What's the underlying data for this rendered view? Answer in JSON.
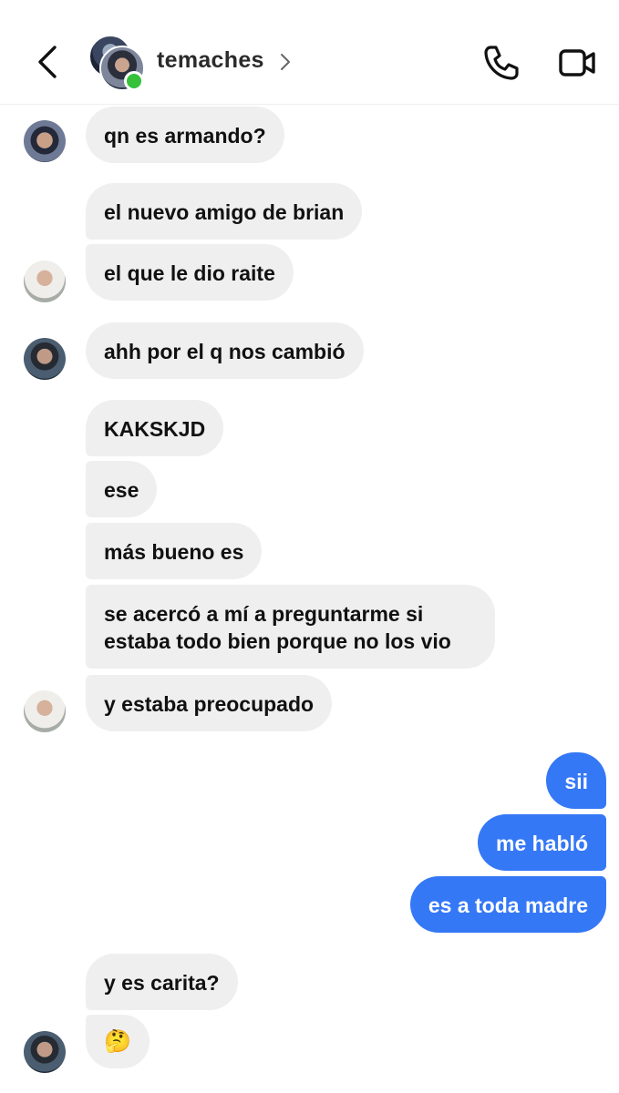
{
  "header": {
    "contact_name": "temaches",
    "online": true,
    "icons": {
      "back": "chevron-left-icon",
      "call": "phone-icon",
      "video": "video-camera-icon",
      "name": "chevron-right-icon"
    }
  },
  "messages": [
    {
      "from": "them",
      "text": "qn es armando?"
    },
    {
      "from": "them",
      "text": "el nuevo amigo de brian"
    },
    {
      "from": "them",
      "text": "el que le dio raite"
    },
    {
      "from": "them",
      "text": "ahh por el q nos cambió"
    },
    {
      "from": "them",
      "text": "KAKSKJD"
    },
    {
      "from": "them",
      "text": "ese"
    },
    {
      "from": "them",
      "text": "más bueno es"
    },
    {
      "from": "them",
      "text": "se acercó a mí a preguntarme si estaba todo bien porque no los vio"
    },
    {
      "from": "them",
      "text": "y estaba preocupado"
    },
    {
      "from": "me",
      "text": "sii"
    },
    {
      "from": "me",
      "text": "me habló"
    },
    {
      "from": "me",
      "text": "es a toda madre"
    },
    {
      "from": "them",
      "text": "y es carita?"
    },
    {
      "from": "them",
      "text": "🤔",
      "emoji": "thinking-face"
    }
  ],
  "colors": {
    "outgoing": "#3578f6",
    "incoming": "#efefef",
    "online": "#36c13b"
  }
}
